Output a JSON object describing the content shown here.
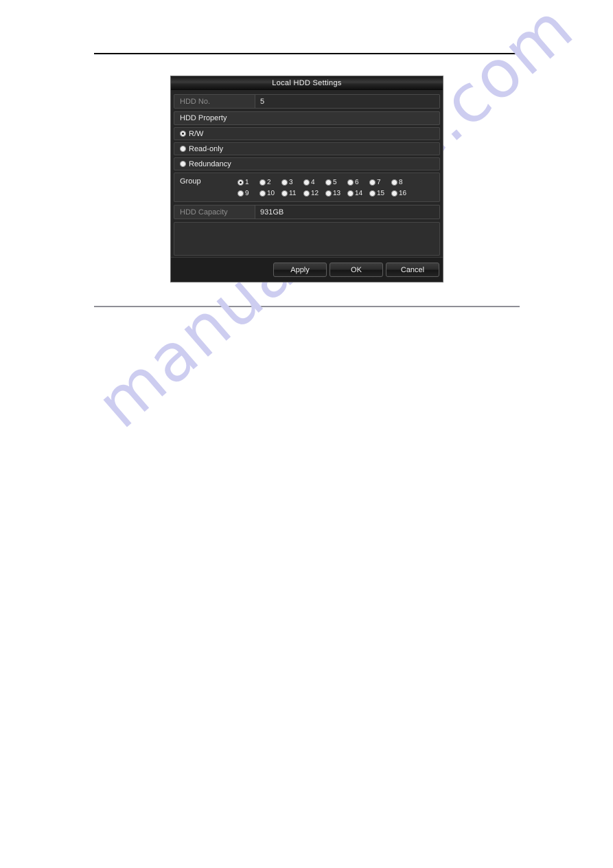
{
  "page": {
    "watermark_text": "manualshive.com",
    "watermark_color": "#cdcdf0"
  },
  "dialog": {
    "title": "Local HDD Settings",
    "hdd_no": {
      "label": "HDD No.",
      "value": "5"
    },
    "hdd_property": {
      "header": "HDD Property",
      "options": [
        {
          "label": "R/W",
          "selected": true
        },
        {
          "label": "Read-only",
          "selected": false
        },
        {
          "label": "Redundancy",
          "selected": false
        }
      ]
    },
    "group": {
      "label": "Group",
      "selected": "1",
      "row1": [
        "1",
        "2",
        "3",
        "4",
        "5",
        "6",
        "7",
        "8"
      ],
      "row2": [
        "9",
        "10",
        "11",
        "12",
        "13",
        "14",
        "15",
        "16"
      ]
    },
    "hdd_capacity": {
      "label": "HDD Capacity",
      "value": "931GB"
    },
    "buttons": {
      "apply": "Apply",
      "ok": "OK",
      "cancel": "Cancel"
    }
  }
}
